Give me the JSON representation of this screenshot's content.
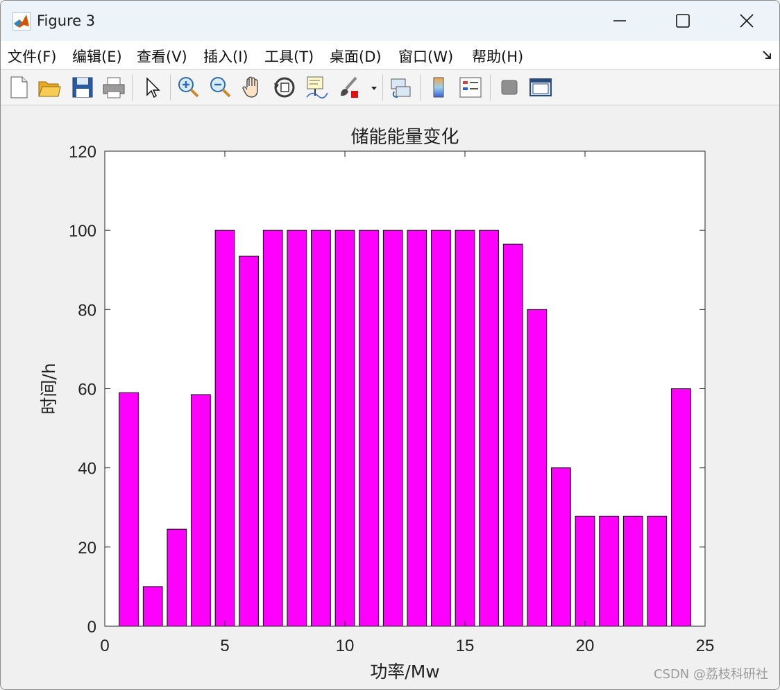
{
  "window": {
    "title": "Figure 3"
  },
  "menubar": {
    "items": [
      "文件(F)",
      "编辑(E)",
      "查看(V)",
      "插入(I)",
      "工具(T)",
      "桌面(D)",
      "窗口(W)",
      "帮助(H)"
    ]
  },
  "toolbar": {
    "icons": [
      "new-figure-icon",
      "open-file-icon",
      "save-icon",
      "print-icon",
      "select-pointer-icon",
      "zoom-in-icon",
      "zoom-out-icon",
      "pan-hand-icon",
      "rotate-3d-icon",
      "data-cursor-icon",
      "brush-icon",
      "brush-dropdown-icon",
      "link-plot-icon",
      "colorbar-icon",
      "legend-icon",
      "hide-plot-tools-icon",
      "show-plot-tools-icon"
    ]
  },
  "chart_data": {
    "type": "bar",
    "title": "储能能量变化",
    "xlabel": "功率/Mw",
    "ylabel": "时间/h",
    "x": [
      1,
      2,
      3,
      4,
      5,
      6,
      7,
      8,
      9,
      10,
      11,
      12,
      13,
      14,
      15,
      16,
      17,
      18,
      19,
      20,
      21,
      22,
      23,
      24
    ],
    "values": [
      59,
      10,
      24.5,
      58.5,
      100,
      93.5,
      100,
      100,
      100,
      100,
      100,
      100,
      100,
      100,
      100,
      100,
      96.5,
      80,
      40,
      27.8,
      27.8,
      27.8,
      27.8,
      60
    ],
    "xlim": [
      0,
      25
    ],
    "ylim": [
      0,
      120
    ],
    "xticks": [
      0,
      5,
      10,
      15,
      20,
      25
    ],
    "yticks": [
      0,
      20,
      40,
      60,
      80,
      100,
      120
    ],
    "grid": false,
    "bar_color": "#ff00ff",
    "edge_color": "#000000"
  },
  "watermark": "CSDN @荔枝科研社"
}
